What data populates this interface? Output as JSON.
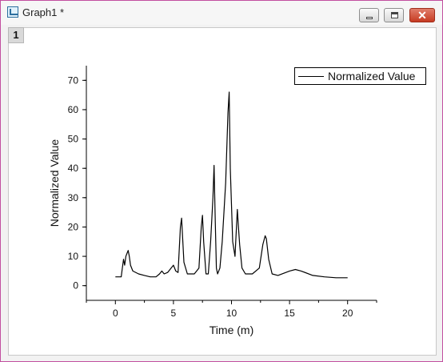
{
  "window": {
    "title": "Graph1 *",
    "close_label": "✕",
    "layer": "1"
  },
  "chart_data": {
    "type": "line",
    "title": "",
    "xlabel": "Time (m)",
    "ylabel": "Normalized Value",
    "xlim": [
      -2.5,
      22.5
    ],
    "ylim": [
      -5,
      75
    ],
    "xticks": [
      0,
      5,
      10,
      15,
      20
    ],
    "yticks": [
      0,
      10,
      20,
      30,
      40,
      50,
      60,
      70
    ],
    "grid": false,
    "legend": {
      "position": "top-right",
      "entries": [
        "Normalized Value"
      ]
    },
    "series": [
      {
        "name": "Normalized Value",
        "color": "#000000",
        "x": [
          0,
          0.5,
          0.6,
          0.7,
          0.75,
          0.8,
          0.9,
          1.0,
          1.1,
          1.2,
          1.3,
          1.5,
          2.0,
          2.5,
          3.0,
          3.5,
          3.8,
          4.0,
          4.2,
          4.5,
          4.8,
          5.0,
          5.2,
          5.4,
          5.6,
          5.7,
          5.9,
          6.2,
          6.8,
          7.2,
          7.4,
          7.5,
          7.6,
          7.8,
          8.0,
          8.2,
          8.4,
          8.5,
          8.6,
          8.7,
          8.8,
          9.0,
          9.2,
          9.5,
          9.7,
          9.8,
          9.9,
          10.1,
          10.3,
          10.5,
          10.6,
          10.7,
          10.9,
          11.2,
          11.8,
          12.4,
          12.7,
          12.9,
          13.0,
          13.2,
          13.5,
          14.0,
          15.0,
          15.5,
          16.0,
          17.0,
          18.0,
          19.0,
          20.0
        ],
        "y": [
          3,
          3,
          6,
          9,
          8,
          7,
          10,
          11,
          12,
          10,
          7,
          5,
          4,
          3.5,
          3,
          3,
          4,
          5,
          4,
          4.5,
          6,
          7,
          5,
          4.5,
          20,
          23,
          8,
          4,
          4,
          6,
          20,
          24,
          15,
          4,
          4,
          15,
          30,
          41,
          22,
          6,
          4,
          6,
          15,
          35,
          59,
          66,
          40,
          15,
          10,
          26,
          20,
          14,
          6,
          4,
          4,
          6,
          14,
          17,
          16,
          9,
          4,
          3.5,
          5,
          5.5,
          5,
          3.5,
          3,
          2.7,
          2.7
        ]
      }
    ]
  }
}
